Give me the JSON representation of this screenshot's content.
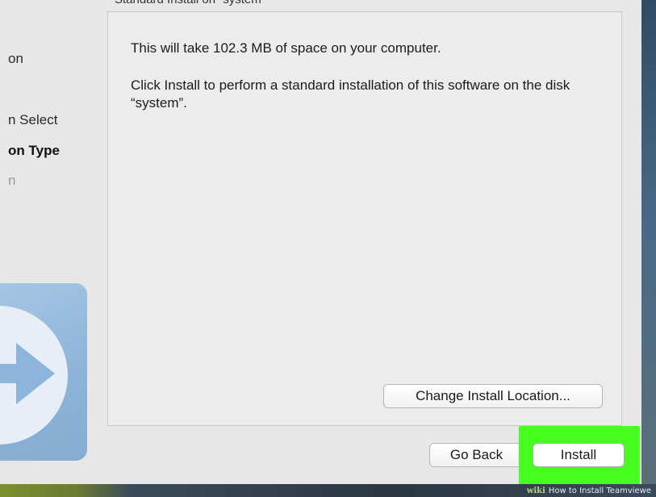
{
  "window": {
    "title_partial": "Standard Install on “system”"
  },
  "sidebar": {
    "steps": [
      {
        "label": "on",
        "state": "done"
      },
      {
        "label": "n Select",
        "state": "done"
      },
      {
        "label": "on Type",
        "state": "active"
      },
      {
        "label": "n",
        "state": "pending"
      }
    ]
  },
  "content": {
    "space_text": "This will take 102.3 MB of space on your computer.",
    "instruction_text": "Click Install to perform a standard installation of this software on the disk “system”."
  },
  "buttons": {
    "change_location": "Change Install Location...",
    "go_back": "Go Back",
    "install": "Install"
  },
  "watermark": {
    "brand": "wiki",
    "text": "How to Install Teamviewe"
  },
  "colors": {
    "highlight": "#46ff1f",
    "window_bg": "#e7e7e7",
    "logo_tile": "#8cb3d8"
  }
}
